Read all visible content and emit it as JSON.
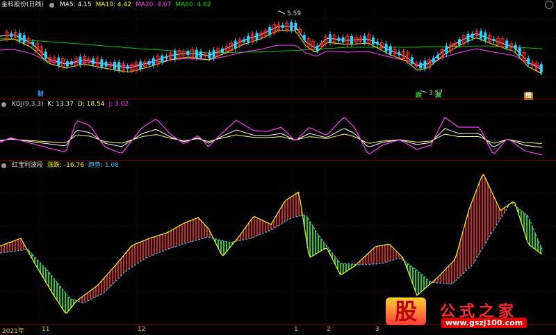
{
  "main_panel": {
    "title": "金科股份(日线)",
    "ma5": "MA5: 4.15",
    "ma10": "MA10: 4.42",
    "ma20": "MA20: 4.67",
    "ma60": "MA60: 4.62",
    "high_label": "5.59",
    "low_label": "3.57",
    "tags": [
      "财",
      "跌",
      "减",
      "榜"
    ],
    "colors": {
      "ma5": "#ffffff",
      "ma10": "#ffff00",
      "ma20": "#ff40ff",
      "ma60": "#00cc00",
      "up": "#ff3030",
      "down": "#30d0ff"
    }
  },
  "kdj_panel": {
    "title": "KDJ(9,3,3)",
    "k": "K: 13.37",
    "d": "D: 18.54",
    "j": "J: 3.02",
    "colors": {
      "k": "#ffffff",
      "d": "#ffff60",
      "j": "#ff40ff"
    }
  },
  "wave_panel": {
    "title": "红宝利波段",
    "zhangdie": "涨跌: -16.76",
    "qushi": "趋势: 1.08",
    "colors": {
      "rise": "#ff3030",
      "fall": "#30ff30",
      "line": "#ffff00",
      "trend": "#40c0ff"
    }
  },
  "time_axis": {
    "year": "2021年",
    "months": [
      "11",
      "12",
      "1",
      "2",
      "3"
    ]
  },
  "watermark": {
    "logo": "股",
    "title": "公式之家",
    "url": "www.gszj100.com"
  }
}
